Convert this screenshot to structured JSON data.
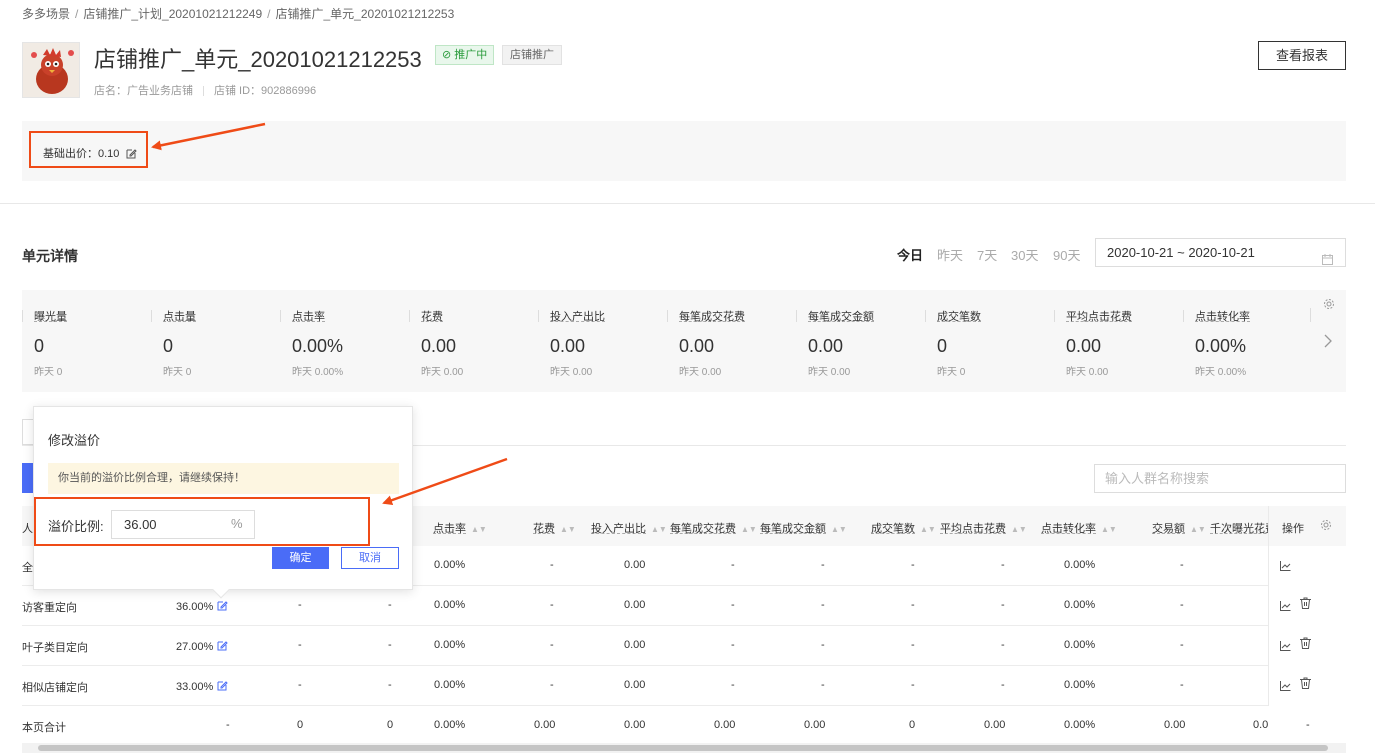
{
  "breadcrumb": {
    "items": [
      "多多场景",
      "店铺推广_计划_20201021212249",
      "店铺推广_单元_20201021212253"
    ],
    "separator": "/"
  },
  "header": {
    "title": "店铺推广_单元_20201021212253",
    "status_badge": "推广中",
    "type_badge": "店铺推广",
    "shop_name": "店名：广告业务店铺",
    "shop_id": "店铺 ID：902886996",
    "report_button": "查看报表"
  },
  "bid": {
    "label": "基础出价：",
    "value": "0.10"
  },
  "section": {
    "title": "单元详情",
    "ranges": [
      "今日",
      "昨天",
      "7天",
      "30天",
      "90天"
    ],
    "active_range": "今日",
    "date_range": "2020-10-21 ~ 2020-10-21"
  },
  "stats": [
    {
      "label": "曝光量",
      "value": "0",
      "yesterday": "昨天 0"
    },
    {
      "label": "点击量",
      "value": "0",
      "yesterday": "昨天 0"
    },
    {
      "label": "点击率",
      "value": "0.00%",
      "yesterday": "昨天 0.00%"
    },
    {
      "label": "花费",
      "value": "0.00",
      "yesterday": "昨天 0.00"
    },
    {
      "label": "投入产出比",
      "value": "0.00",
      "yesterday": "昨天 0.00"
    },
    {
      "label": "每笔成交花费",
      "value": "0.00",
      "yesterday": "昨天 0.00"
    },
    {
      "label": "每笔成交金额",
      "value": "0.00",
      "yesterday": "昨天 0.00"
    },
    {
      "label": "成交笔数",
      "value": "0",
      "yesterday": "昨天 0"
    },
    {
      "label": "平均点击花费",
      "value": "0.00",
      "yesterday": "昨天 0.00"
    },
    {
      "label": "点击转化率",
      "value": "0.00%",
      "yesterday": "昨天 0.00%"
    }
  ],
  "search": {
    "placeholder": "输入人群名称搜索"
  },
  "table": {
    "first_col_partial": "人",
    "headers": [
      "点击率",
      "花费",
      "投入产出比",
      "每笔成交花费",
      "每笔成交金额",
      "成交笔数",
      "平均点击花费",
      "点击转化率",
      "交易额",
      "千次曝光花费"
    ],
    "ops_header": "操作",
    "rows": [
      {
        "name": "全",
        "premium": "",
        "c1": "-",
        "c2": "-",
        "ctr": "0.00%",
        "cost": "-",
        "roi": "0.00",
        "cpo": "-",
        "aov": "-",
        "orders": "-",
        "cpc": "-",
        "cvr": "0.00%",
        "gmv": "-",
        "cpm": ""
      },
      {
        "name": "访客重定向",
        "premium": "36.00%",
        "c1": "-",
        "c2": "-",
        "ctr": "0.00%",
        "cost": "-",
        "roi": "0.00",
        "cpo": "-",
        "aov": "-",
        "orders": "-",
        "cpc": "-",
        "cvr": "0.00%",
        "gmv": "-",
        "cpm": ""
      },
      {
        "name": "叶子类目定向",
        "premium": "27.00%",
        "c1": "-",
        "c2": "-",
        "ctr": "0.00%",
        "cost": "-",
        "roi": "0.00",
        "cpo": "-",
        "aov": "-",
        "orders": "-",
        "cpc": "-",
        "cvr": "0.00%",
        "gmv": "-",
        "cpm": ""
      },
      {
        "name": "相似店铺定向",
        "premium": "33.00%",
        "c1": "-",
        "c2": "-",
        "ctr": "0.00%",
        "cost": "-",
        "roi": "0.00",
        "cpo": "-",
        "aov": "-",
        "orders": "-",
        "cpc": "-",
        "cvr": "0.00%",
        "gmv": "-",
        "cpm": ""
      },
      {
        "name": "本页合计",
        "premium": "-",
        "c1": "0",
        "c2": "0",
        "ctr": "0.00%",
        "cost": "0.00",
        "roi": "0.00",
        "cpo": "0.00",
        "aov": "0.00",
        "orders": "0",
        "cpc": "0.00",
        "cvr": "0.00%",
        "gmv": "0.00",
        "cpm": "0.0"
      }
    ],
    "total_ops": "-"
  },
  "popover": {
    "title": "修改溢价",
    "tip": "你当前的溢价比例合理，请继续保持！",
    "label": "溢价比例:",
    "value": "36.00",
    "unit": "%",
    "ok": "确定",
    "cancel": "取消"
  },
  "colors": {
    "accent": "#4a6cf7",
    "annotation": "#ef4b17",
    "success": "#2a9b3c"
  }
}
